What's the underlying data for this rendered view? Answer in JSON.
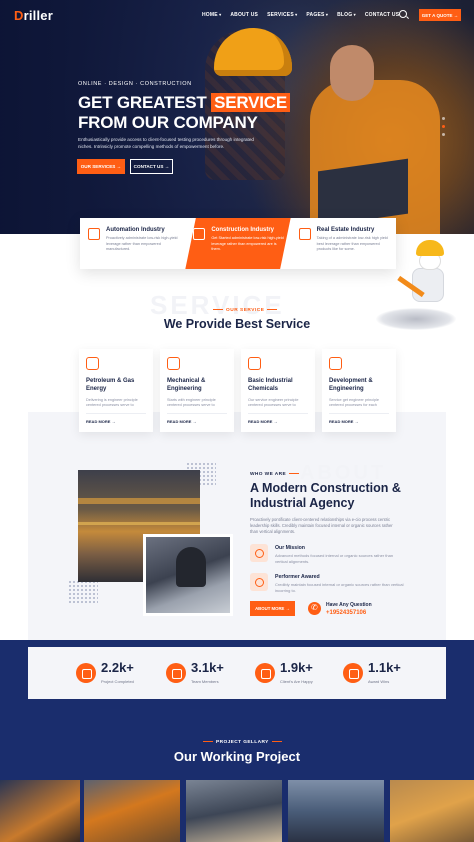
{
  "nav": {
    "logo_prefix": "D",
    "logo_rest": "riller",
    "items": [
      "HOME",
      "ABOUT US",
      "SERVICES",
      "PAGES",
      "BLOG",
      "CONTACT US"
    ],
    "quote_button": "GET A QUOTE →"
  },
  "hero": {
    "eyebrow": "ONLINE · DESIGN · CONSTRUCTION",
    "title_line1_a": "GET GREATEST ",
    "title_line1_highlight": "SERVICE",
    "title_line2": "FROM OUR COMPANY",
    "paragraph": "Enthusiastically provide access to client-focused testing procedures through integrated niches. Intrinsicly promote compelling methods of empowerment before.",
    "btn_primary": "OUR SERVICES →",
    "btn_secondary": "CONTACT US →"
  },
  "industries": [
    {
      "title": "Automation Industry",
      "desc": "Proactively administrate low-risk high-yield leverage rather than empowered manufactured.",
      "icon": "crane-icon"
    },
    {
      "title": "Construction Industry",
      "desc": "Get Started administrate low-risk high-yield leverage rather than empowered are is them.",
      "icon": "helmet-icon"
    },
    {
      "title": "Real Estate Industry",
      "desc": "Taking of a administrate low-risk high yield best leverage rather than empowered products like for some.",
      "icon": "building-icon"
    }
  ],
  "services": {
    "ghost": "SERVICE",
    "eyebrow": "OUR SERVICE",
    "title": "We Provide Best Service",
    "cards": [
      {
        "title": "Petroleum & Gas Energy",
        "desc": "Delivering is engineer principle centered processes serve to",
        "more": "READ MORE →",
        "icon": "oil-tank-icon"
      },
      {
        "title": "Mechanical & Engineering",
        "desc": "Starts with engineer principle centered processes serve to",
        "more": "READ MORE →",
        "icon": "gear-icon"
      },
      {
        "title": "Basic Industrial Chemicals",
        "desc": "Our service engineer principle centered processes serve to",
        "more": "READ MORE →",
        "icon": "factory-icon"
      },
      {
        "title": "Development & Engineering",
        "desc": "Service get engineer principle centered processes for each",
        "more": "READ MORE →",
        "icon": "tower-icon"
      }
    ]
  },
  "about": {
    "ghost": "ABOUT",
    "eyebrow": "WHO WE ARE",
    "title": "A Modern Construction & Industrial Agency",
    "paragraph": "Proactively pontificate client-centered relationships via e-cio process centric leadership skills. Credibly maintain focused internal or organic sources rather than vertical alignments.",
    "features": [
      {
        "title": "Our Mission",
        "desc": "Advanced methods focused internal or organic sources rather than vertical alignments."
      },
      {
        "title": "Performer Awared",
        "desc": "Credibly maintain focused internal or organic sources rather than vertical incorring to."
      }
    ],
    "button": "ABOUT MORE →",
    "question_label": "Have Any Question",
    "phone": "+19524357106"
  },
  "stats": [
    {
      "value": "2.2k+",
      "label": "Project Completed"
    },
    {
      "value": "3.1k+",
      "label": "Team Members"
    },
    {
      "value": "1.9k+",
      "label": "Client's Are Happy"
    },
    {
      "value": "1.1k+",
      "label": "Award Wins"
    }
  ],
  "projects": {
    "eyebrow": "PROJECT GELLARY",
    "title": "Our Working Project"
  },
  "colors": {
    "accent": "#ff5e14",
    "navy": "#1a2d6d",
    "text": "#1b2547"
  }
}
